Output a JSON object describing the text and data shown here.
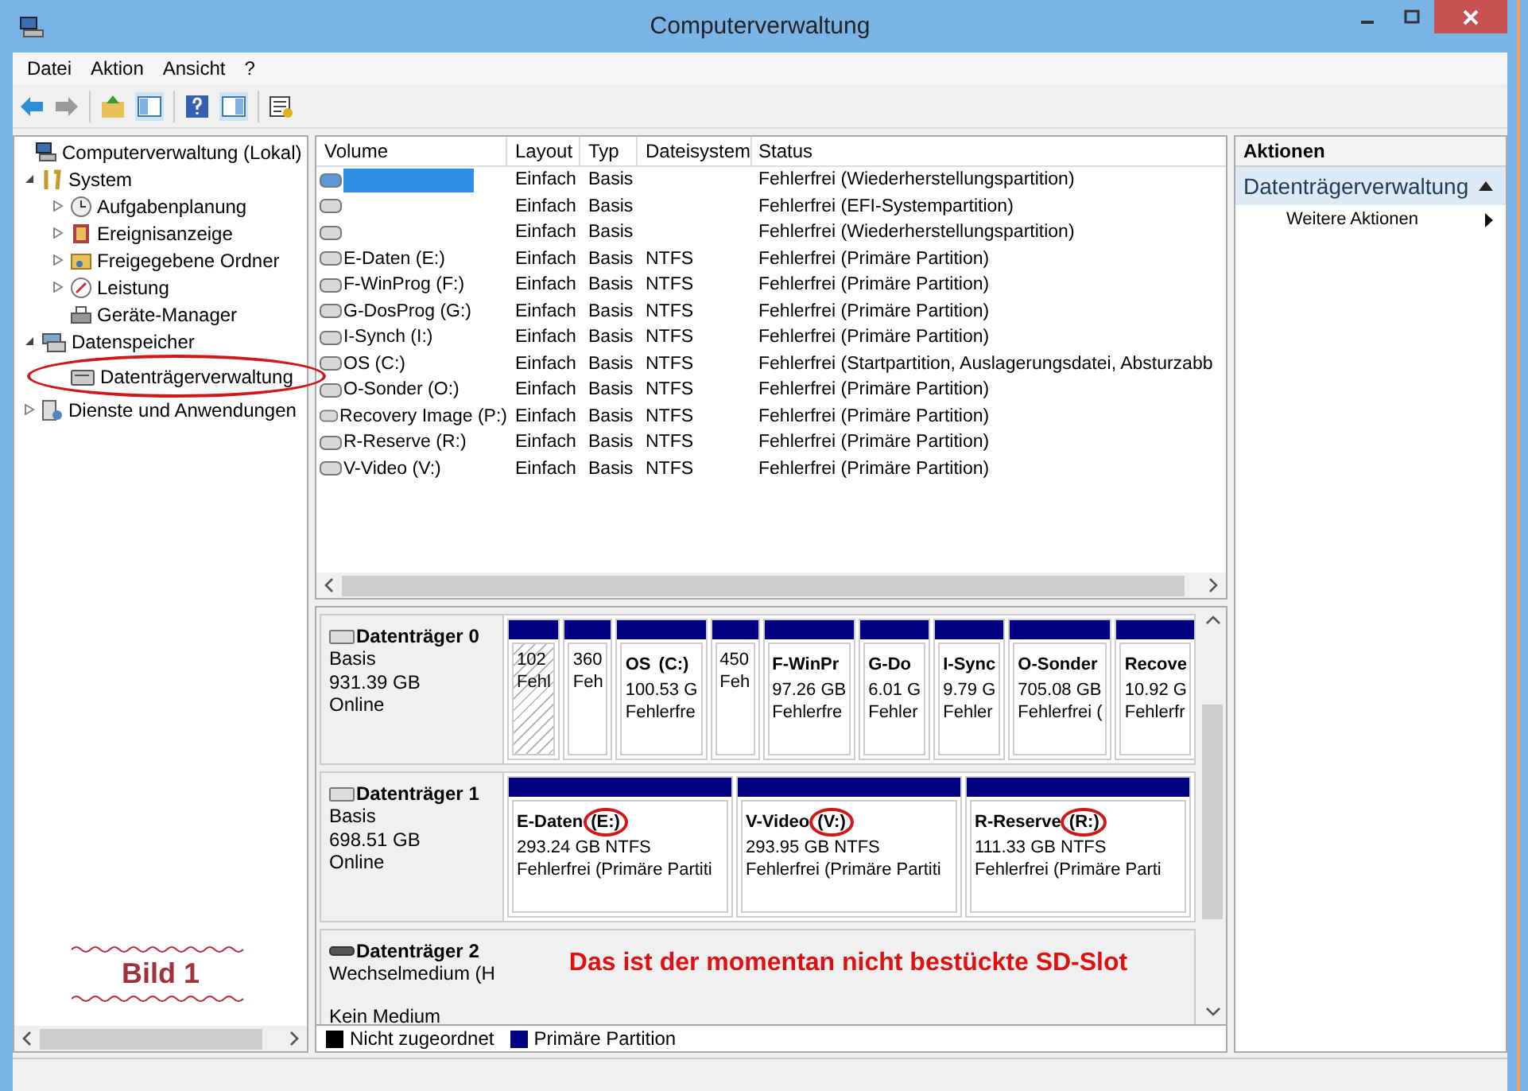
{
  "window": {
    "title": "Computerverwaltung"
  },
  "menu": [
    {
      "label": "Datei"
    },
    {
      "label": "Aktion"
    },
    {
      "label": "Ansicht"
    },
    {
      "label": "?"
    }
  ],
  "tree": [
    {
      "label": "Computerverwaltung (Lokal)",
      "children": [
        {
          "label": "System",
          "expanded": true,
          "children": [
            {
              "label": "Aufgabenplanung",
              "expanded": false
            },
            {
              "label": "Ereignisanzeige",
              "expanded": false
            },
            {
              "label": "Freigegebene Ordner",
              "expanded": false
            },
            {
              "label": "Leistung",
              "expanded": false
            },
            {
              "label": "Geräte-Manager"
            }
          ]
        },
        {
          "label": "Datenspeicher",
          "expanded": true,
          "children": [
            {
              "label": "Datenträgerverwaltung",
              "circled": true
            }
          ]
        },
        {
          "label": "Dienste und Anwendungen",
          "expanded": false
        }
      ]
    }
  ],
  "note": {
    "text": "Bild 1"
  },
  "table": {
    "columns": [
      "Volume",
      "Layout",
      "Typ",
      "Dateisystem",
      "Status"
    ],
    "rows": [
      {
        "redacted": true,
        "layout": "Einfach",
        "type": "Basis",
        "status": "Fehlerfrei (Wiederherstellungspartition)"
      },
      {
        "redacted": false,
        "layout": "Einfach",
        "type": "Basis",
        "status": "Fehlerfrei (EFI-Systempartition)"
      },
      {
        "redacted": false,
        "layout": "Einfach",
        "type": "Basis",
        "status": "Fehlerfrei (Wiederherstellungspartition)"
      },
      {
        "volume": "E-Daten (E:)",
        "redacted": false,
        "layout": "Einfach",
        "type": "Basis",
        "fs": "NTFS",
        "status": "Fehlerfrei (Primäre Partition)"
      },
      {
        "volume": "F-WinProg (F:)",
        "redacted": false,
        "layout": "Einfach",
        "type": "Basis",
        "fs": "NTFS",
        "status": "Fehlerfrei (Primäre Partition)"
      },
      {
        "volume": "G-DosProg (G:)",
        "redacted": false,
        "layout": "Einfach",
        "type": "Basis",
        "fs": "NTFS",
        "status": "Fehlerfrei (Primäre Partition)"
      },
      {
        "volume": "I-Synch (I:)",
        "redacted": false,
        "layout": "Einfach",
        "type": "Basis",
        "fs": "NTFS",
        "status": "Fehlerfrei (Primäre Partition)"
      },
      {
        "volume": "OS (C:)",
        "redacted": false,
        "layout": "Einfach",
        "type": "Basis",
        "fs": "NTFS",
        "status": "Fehlerfrei (Startpartition, Auslagerungsdatei, Absturzabb"
      },
      {
        "volume": "O-Sonder (O:)",
        "redacted": false,
        "layout": "Einfach",
        "type": "Basis",
        "fs": "NTFS",
        "status": "Fehlerfrei (Primäre Partition)"
      },
      {
        "volume": "Recovery Image (P:)",
        "redacted": false,
        "layout": "Einfach",
        "type": "Basis",
        "fs": "NTFS",
        "status": "Fehlerfrei (Primäre Partition)"
      },
      {
        "volume": "R-Reserve (R:)",
        "redacted": false,
        "layout": "Einfach",
        "type": "Basis",
        "fs": "NTFS",
        "status": "Fehlerfrei (Primäre Partition)"
      },
      {
        "volume": "V-Video (V:)",
        "redacted": false,
        "layout": "Einfach",
        "type": "Basis",
        "fs": "NTFS",
        "status": "Fehlerfrei (Primäre Partition)"
      }
    ]
  },
  "disks": [
    {
      "name": "Datenträger 0",
      "kind": "fixed",
      "lines": [
        "Basis",
        "931.39 GB",
        "Online"
      ],
      "partitions": [
        {
          "size": "102",
          "status": "Fehl",
          "hatched": true
        },
        {
          "size": "360",
          "status": "Feh",
          "hatched": false
        },
        {
          "name": "OS",
          "letter": "(C:)",
          "circled": false,
          "size": "100.53 G",
          "status": "Fehlerfre",
          "hatched": false
        },
        {
          "size": "450",
          "status": "Feh",
          "hatched": false
        },
        {
          "name": "F-WinPr",
          "size": "97.26 GB",
          "status": "Fehlerfre",
          "hatched": false
        },
        {
          "name": "G-Do",
          "size": "6.01 G",
          "status": "Fehler",
          "hatched": false
        },
        {
          "name": "I-Sync",
          "size": "9.79 G",
          "status": "Fehler",
          "hatched": false
        },
        {
          "name": "O-Sonder",
          "size": "705.08 GB",
          "status": "Fehlerfrei (",
          "hatched": false
        },
        {
          "name": "Recove",
          "size": "10.92 G",
          "status": "Fehlerfr",
          "hatched": false
        }
      ]
    },
    {
      "name": "Datenträger 1",
      "kind": "fixed",
      "lines": [
        "Basis",
        "698.51 GB",
        "Online"
      ],
      "partitions": [
        {
          "name": "E-Daten",
          "letter": "(E:)",
          "circled": true,
          "size": "293.24 GB NTFS",
          "status": "Fehlerfrei (Primäre Partiti",
          "hatched": false
        },
        {
          "name": "V-Video",
          "letter": "(V:)",
          "circled": true,
          "size": "293.95 GB NTFS",
          "status": "Fehlerfrei (Primäre Partiti",
          "hatched": false
        },
        {
          "name": "R-Reserve",
          "letter": "(R:)",
          "circled": true,
          "size": "111.33 GB NTFS",
          "status": "Fehlerfrei (Primäre Parti",
          "hatched": false
        }
      ]
    },
    {
      "name": "Datenträger 2",
      "kind": "removable",
      "lines": [
        "Wechselmedium (H"
      ],
      "state": "Kein Medium",
      "note": "Das ist der momentan nicht bestückte SD-Slot"
    }
  ],
  "legend": [
    {
      "label": "Nicht zugeordnet",
      "color": "#000000"
    },
    {
      "label": "Primäre Partition",
      "color": "#000080"
    }
  ],
  "actions": {
    "title": "Aktionen",
    "section": "Datenträgerverwaltung",
    "items": [
      "Weitere Aktionen"
    ]
  }
}
